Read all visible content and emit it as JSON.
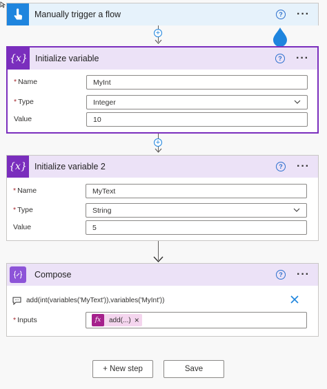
{
  "trigger": {
    "title": "Manually trigger a flow",
    "help": "?",
    "more": "···"
  },
  "init1": {
    "title": "Initialize variable",
    "icon_text": "{x}",
    "help": "?",
    "more": "···",
    "name_label": "Name",
    "name_value": "MyInt",
    "type_label": "Type",
    "type_value": "Integer",
    "value_label": "Value",
    "value_value": "10"
  },
  "init2": {
    "title": "Initialize variable 2",
    "icon_text": "{x}",
    "help": "?",
    "more": "···",
    "name_label": "Name",
    "name_value": "MyText",
    "type_label": "Type",
    "type_value": "String",
    "value_label": "Value",
    "value_value": "5"
  },
  "compose": {
    "title": "Compose",
    "help": "?",
    "more": "···",
    "expression": "add(int(variables('MyText')),variables('MyInt'))",
    "inputs_label": "Inputs",
    "token_icon": "fx",
    "token_label": "add(...)",
    "token_remove": "×"
  },
  "required_mark": "*",
  "plus_symbol": "+",
  "buttons": {
    "new_step": "+ New step",
    "save": "Save"
  },
  "colors": {
    "accent_blue": "#1f85de",
    "accent_purple": "#7a2ebd",
    "token_pink": "#f4d5ee"
  }
}
